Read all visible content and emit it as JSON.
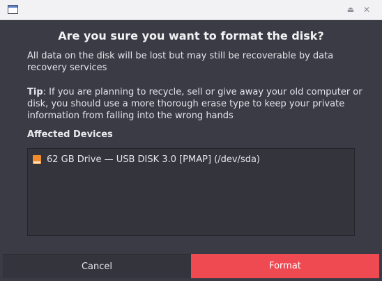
{
  "window": {
    "title_icon": "window-icon",
    "shade_glyph": "⏏",
    "close_glyph": "✕"
  },
  "dialog": {
    "heading": "Are you sure you want to format the disk?",
    "warning_text": "All data on the disk will be lost but may still be recoverable by data recovery services",
    "tip_label": "Tip",
    "tip_text": ": If you are planning to recycle, sell or give away your old computer or disk, you should use a more thorough erase type to keep your private information from falling into the wrong hands",
    "affected_title": "Affected Devices",
    "devices": [
      {
        "icon": "drive-icon",
        "label": "62 GB Drive — USB DISK 3.0 [PMAP] (/dev/sda)"
      }
    ],
    "buttons": {
      "cancel": "Cancel",
      "format": "Format"
    }
  },
  "colors": {
    "background": "#3a3b44",
    "destructive": "#ef4952",
    "drive_icon": "#f08c2c"
  }
}
